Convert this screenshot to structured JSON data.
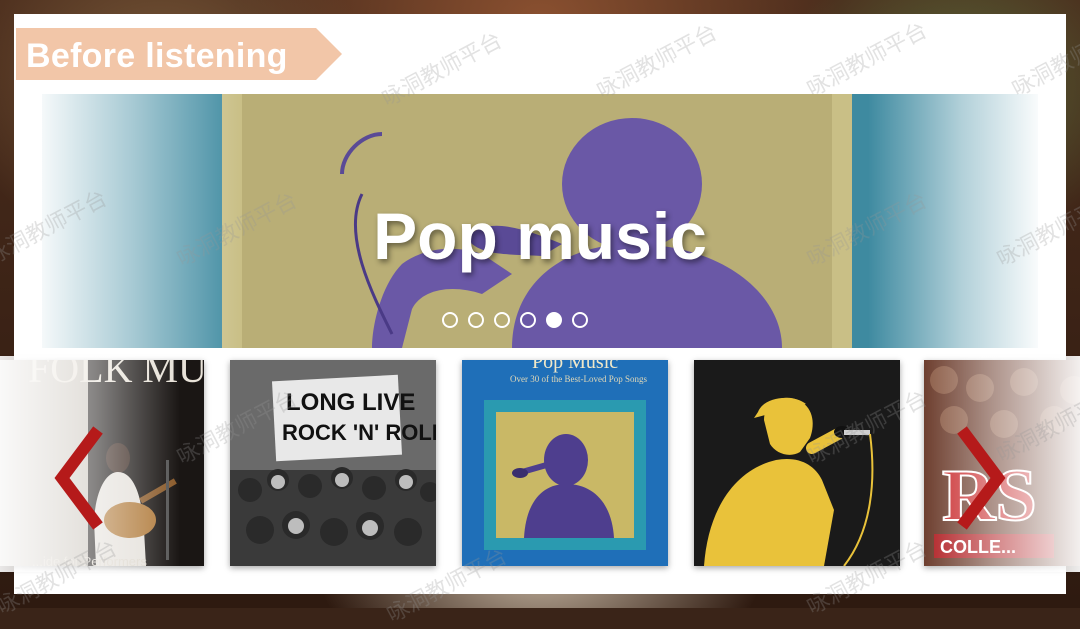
{
  "section": {
    "label": "Before listening"
  },
  "hero": {
    "title": "Pop music",
    "slide_count": 6,
    "active_slide": 5
  },
  "albums": [
    {
      "name": "folk",
      "title": "FOLK MUSIC",
      "subtitle": "...ide for Performers"
    },
    {
      "name": "rock",
      "banner_line1": "LONG LIVE",
      "banner_line2": "ROCK 'N' ROLL"
    },
    {
      "name": "pop",
      "title": "Pop Music",
      "subtitle": "Over 30 of the Best-Loved Pop Songs"
    },
    {
      "name": "singer"
    },
    {
      "name": "rs",
      "title": "RS",
      "subtitle": "COLLE..."
    }
  ],
  "watermark": "咏洞教师平台",
  "colors": {
    "tag": "#f2c6a8",
    "arrow": "#b51a1a",
    "panel": "#ffffff"
  }
}
